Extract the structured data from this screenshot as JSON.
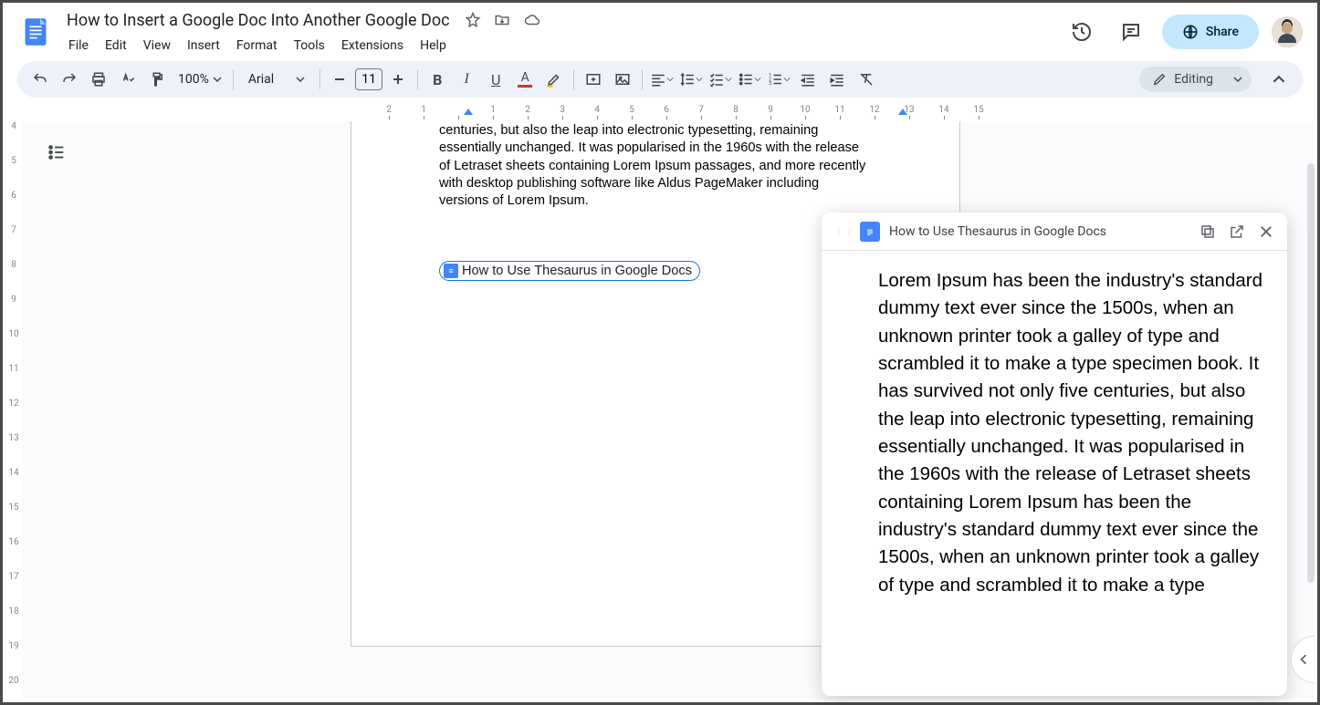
{
  "doc_title": "How to Insert a Google Doc Into Another Google Doc",
  "menus": [
    "File",
    "Edit",
    "View",
    "Insert",
    "Format",
    "Tools",
    "Extensions",
    "Help"
  ],
  "toolbar": {
    "zoom": "100%",
    "font": "Arial",
    "size": "11",
    "editing_label": "Editing"
  },
  "share_label": "Share",
  "body_paragraph": "centuries, but also the leap into electronic typesetting, remaining essentially unchanged. It was popularised in the 1960s with the release of Letraset sheets containing Lorem Ipsum passages, and more recently with desktop publishing software like Aldus PageMaker including versions of Lorem Ipsum.",
  "chip_label": "How to Use Thesaurus in Google Docs",
  "preview": {
    "title": "How to Use Thesaurus in Google Docs",
    "body": "Lorem Ipsum has been the industry's standard dummy text ever since the 1500s, when an unknown printer took a galley of type and scrambled it to make a type specimen book. It has survived not only five centuries, but also the leap into electronic typesetting, remaining essentially unchanged. It was popularised in the 1960s with the release of Letraset sheets containing Lorem Ipsum has been the industry's standard dummy text ever since the 1500s, when an unknown printer took a galley of type and scrambled it to make a type"
  },
  "ruler_h": [
    "2",
    "1",
    "",
    "1",
    "2",
    "3",
    "4",
    "5",
    "6",
    "7",
    "8",
    "9",
    "10",
    "11",
    "12",
    "13",
    "14",
    "15"
  ],
  "ruler_v": [
    "4",
    "5",
    "6",
    "7",
    "8",
    "9",
    "10",
    "11",
    "12",
    "13",
    "14",
    "15",
    "16",
    "17",
    "18",
    "19",
    "20"
  ]
}
